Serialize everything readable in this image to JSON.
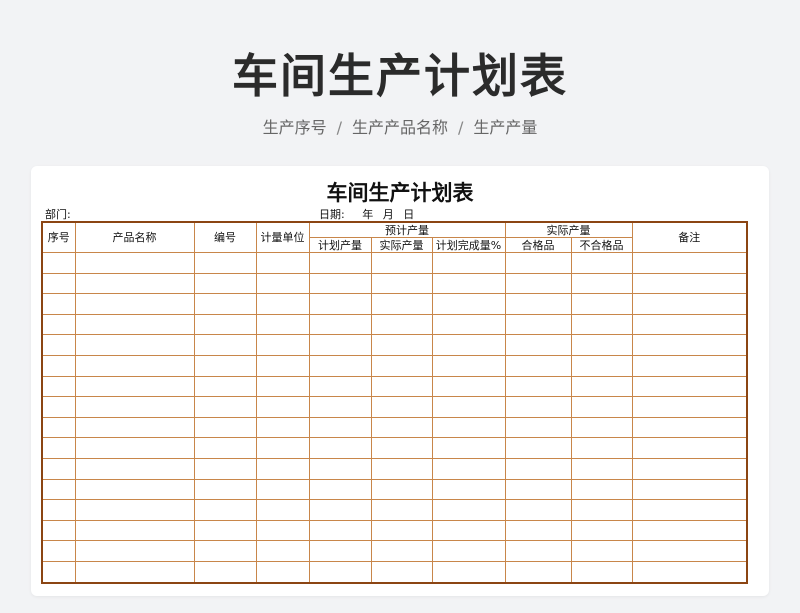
{
  "hero": {
    "title": "车间生产计划表",
    "subtitle_items": [
      "生产序号",
      "生产产品名称",
      "生产产量"
    ],
    "separator": "/"
  },
  "sheet": {
    "title": "车间生产计划表",
    "dept_label": "部门:",
    "date_label": "日期:",
    "date_parts": [
      "年",
      "月",
      "日"
    ],
    "headers": {
      "seq": "序号",
      "product_name": "产品名称",
      "code": "编号",
      "unit": "计量单位",
      "planned_group": "预计产量",
      "planned_output": "计划产量",
      "actual_output": "实际产量",
      "completion_rate": "计划完成量%",
      "actual_group": "实际产量",
      "qualified": "合格品",
      "unqualified": "不合格品",
      "remarks": "备注"
    },
    "empty_rows": 16
  },
  "colors": {
    "background": "#f2f3f5",
    "table_border": "#8b4513",
    "grid_line": "#c8864a"
  }
}
